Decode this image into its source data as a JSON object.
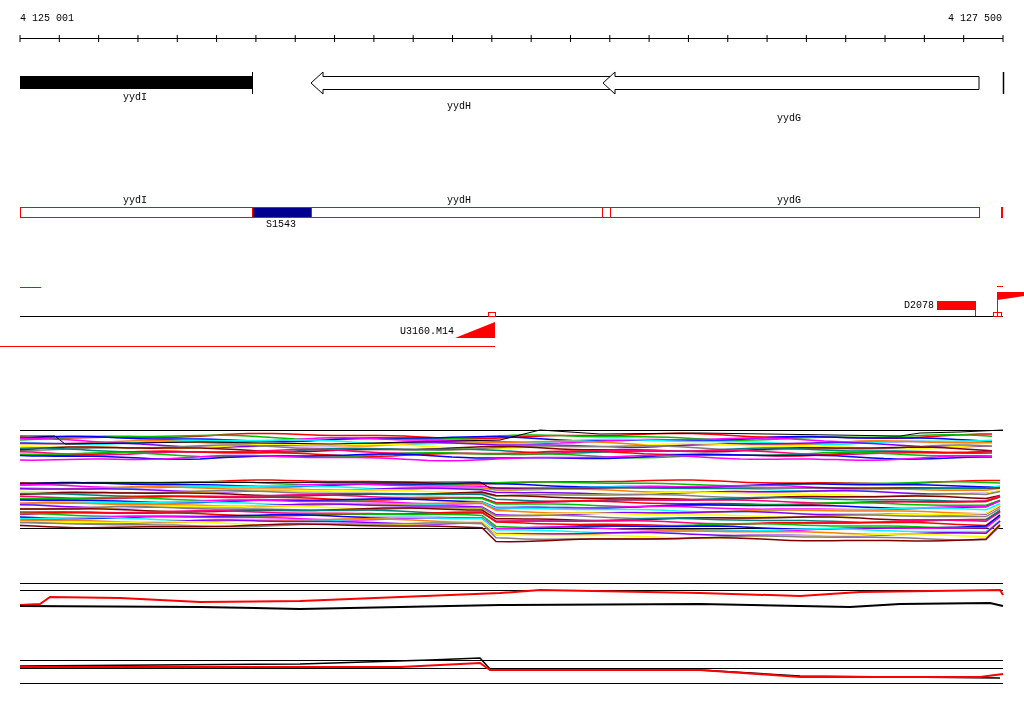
{
  "ruler": {
    "start": "4 125 001",
    "end": "4 127 500"
  },
  "genes": [
    {
      "name": "yydI",
      "kind": "block"
    },
    {
      "name": "yydH",
      "kind": "arrow"
    },
    {
      "name": "yydG",
      "kind": "arrow"
    }
  ],
  "annotations": [
    {
      "name": "yydI",
      "kind": "gene"
    },
    {
      "name": "S1543",
      "kind": "site"
    },
    {
      "name": "yydH",
      "kind": "gene"
    },
    {
      "name": "yydG",
      "kind": "gene"
    }
  ],
  "features": [
    {
      "name": "U3160.M14",
      "kind": "ramp"
    },
    {
      "name": "D2078",
      "kind": "bar"
    }
  ]
}
